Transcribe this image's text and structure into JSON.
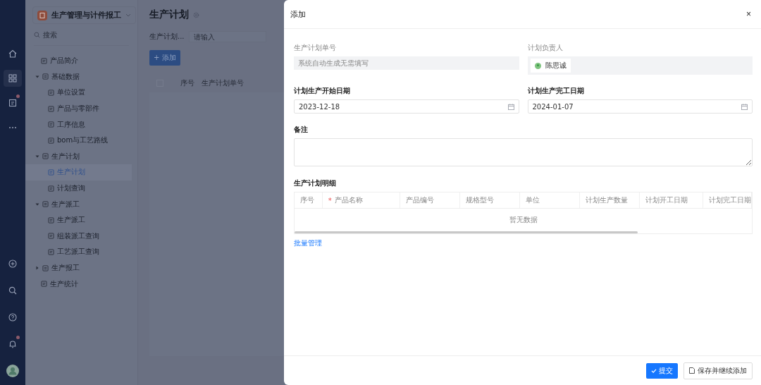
{
  "rail": {
    "items": [
      {
        "kind": "home",
        "selected": false,
        "badge": false
      },
      {
        "kind": "apps",
        "selected": true,
        "badge": false
      },
      {
        "kind": "doc",
        "selected": false,
        "badge": true
      },
      {
        "kind": "more",
        "selected": false,
        "badge": false
      }
    ],
    "bottom": [
      {
        "kind": "plus",
        "badge": false
      },
      {
        "kind": "search",
        "badge": false
      },
      {
        "kind": "help",
        "badge": false
      },
      {
        "kind": "bell",
        "badge": true
      },
      {
        "kind": "avatar",
        "badge": false
      }
    ]
  },
  "sidebar": {
    "app_title": "生产管理与计件报工",
    "search_placeholder": "搜索",
    "tree": [
      {
        "label": "产品简介",
        "selected": false
      },
      {
        "label": "基础数据",
        "expanded": true,
        "children": [
          {
            "label": "单位设置",
            "selected": false
          },
          {
            "label": "产品与零部件",
            "selected": false
          },
          {
            "label": "工序信息",
            "selected": false
          },
          {
            "label": "bom与工艺路线",
            "selected": false
          }
        ]
      },
      {
        "label": "生产计划",
        "expanded": true,
        "children": [
          {
            "label": "生产计划",
            "selected": true
          },
          {
            "label": "计划查询",
            "selected": false
          }
        ]
      },
      {
        "label": "生产派工",
        "expanded": true,
        "children": [
          {
            "label": "生产派工",
            "selected": false
          },
          {
            "label": "组装派工查询",
            "selected": false
          },
          {
            "label": "工艺派工查询",
            "selected": false
          }
        ]
      },
      {
        "label": "生产报工",
        "expanded": false
      },
      {
        "label": "生产统计",
        "selected": false
      }
    ]
  },
  "page": {
    "title": "生产计划",
    "filter_label": "生产计划...",
    "filter_placeholder": "请输入",
    "add_button": "+ 添加",
    "select_all_checked": false,
    "columns": [
      "序号",
      "生产计划单号"
    ]
  },
  "drawer": {
    "title": "添加",
    "close": "×",
    "order_no": {
      "label": "生产计划单号",
      "placeholder": "系统自动生成无需填写"
    },
    "owner": {
      "label": "计划负责人",
      "value": "陈思诚"
    },
    "start": {
      "label": "计划生产开始日期",
      "value": "2023-12-18"
    },
    "end": {
      "label": "计划生产完工日期",
      "value": "2024-01-07"
    },
    "remark": {
      "label": "备注"
    },
    "detail": {
      "label": "生产计划明细",
      "columns": [
        {
          "label": "序号",
          "required": false
        },
        {
          "label": "产品名称",
          "required": true
        },
        {
          "label": "产品编号",
          "required": false
        },
        {
          "label": "规格型号",
          "required": false
        },
        {
          "label": "单位",
          "required": false
        },
        {
          "label": "计划生产数量",
          "required": false
        },
        {
          "label": "计划开工日期",
          "required": false
        },
        {
          "label": "计划完工日期",
          "required": false
        }
      ],
      "required_mark": "*",
      "empty": "暂无数据"
    },
    "batch_link": "批量管理",
    "submit": "提交",
    "save_continue": "保存并继续添加"
  }
}
